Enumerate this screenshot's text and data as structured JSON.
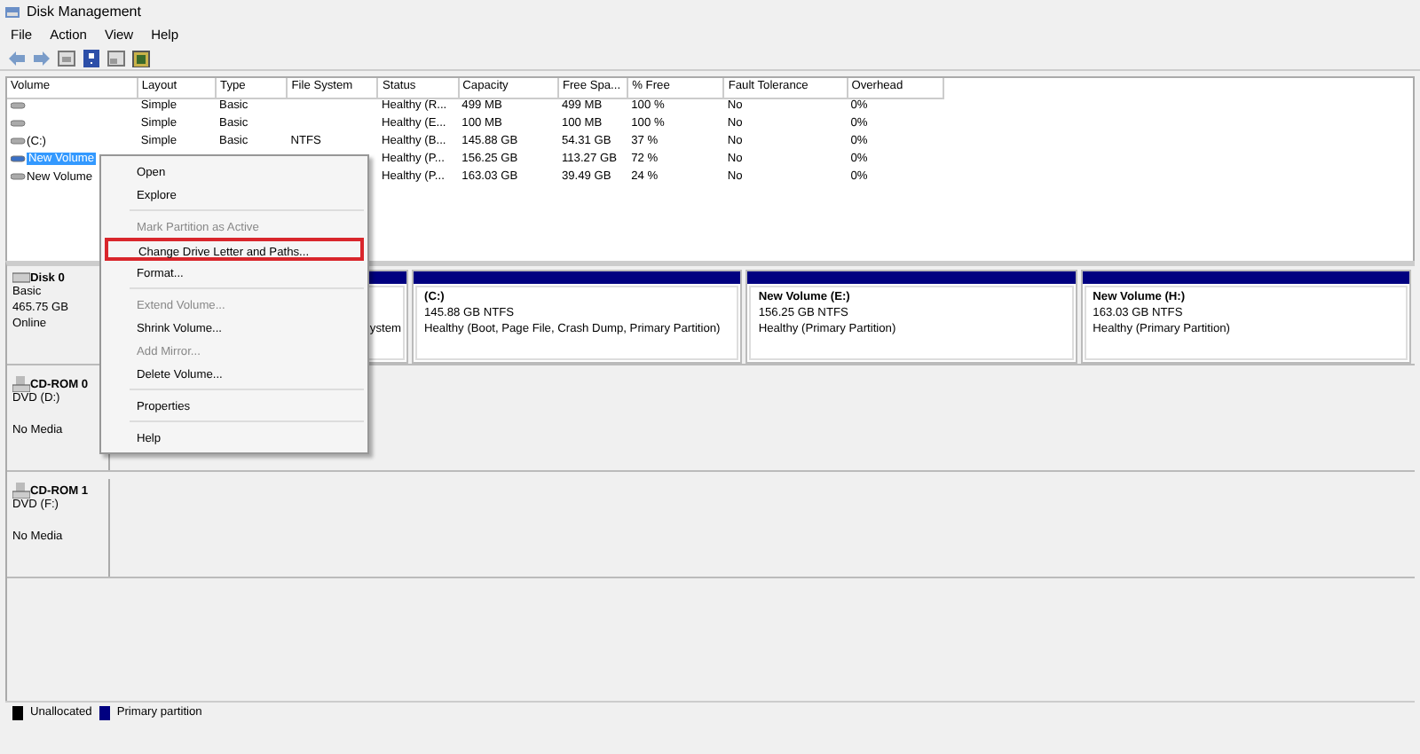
{
  "window": {
    "title": "Disk Management"
  },
  "menu_bar": [
    "File",
    "Action",
    "View",
    "Help"
  ],
  "table": {
    "columns": [
      "Volume",
      "Layout",
      "Type",
      "File System",
      "Status",
      "Capacity",
      "Free Spa...",
      "% Free",
      "Fault Tolerance",
      "Overhead"
    ],
    "rows": [
      {
        "selected": false,
        "cells": [
          "",
          "Simple",
          "Basic",
          "",
          "Healthy (R...",
          "499 MB",
          "499 MB",
          "100 %",
          "No",
          "0%"
        ]
      },
      {
        "selected": false,
        "cells": [
          "",
          "Simple",
          "Basic",
          "",
          "Healthy (E...",
          "100 MB",
          "100 MB",
          "100 %",
          "No",
          "0%"
        ]
      },
      {
        "selected": false,
        "cells": [
          "(C:)",
          "Simple",
          "Basic",
          "NTFS",
          "Healthy (B...",
          "145.88 GB",
          "54.31 GB",
          "37 %",
          "No",
          "0%"
        ]
      },
      {
        "selected": true,
        "cells": [
          "New Volume",
          "",
          "",
          "",
          "Healthy (P...",
          "156.25 GB",
          "113.27 GB",
          "72 %",
          "No",
          "0%"
        ]
      },
      {
        "selected": false,
        "cells": [
          "New Volume",
          "",
          "",
          "",
          "Healthy (P...",
          "163.03 GB",
          "39.49 GB",
          "24 %",
          "No",
          "0%"
        ]
      }
    ]
  },
  "disks": [
    {
      "kind": "disk",
      "name": "Disk 0",
      "lines": [
        "Basic",
        "465.75 GB",
        "Online"
      ],
      "partitions": [
        {
          "color": "#000080",
          "status": "ystem"
        },
        {
          "color": "#000080",
          "title": "(C:)",
          "size": "145.88 GB NTFS",
          "status": "Healthy (Boot, Page File, Crash Dump, Primary Partition)"
        },
        {
          "color": "#000080",
          "title": "New Volume  (E:)",
          "size": "156.25 GB NTFS",
          "status": "Healthy (Primary Partition)"
        },
        {
          "color": "#000080",
          "title": "New Volume  (H:)",
          "size": "163.03 GB NTFS",
          "status": "Healthy (Primary Partition)"
        }
      ]
    },
    {
      "kind": "cdrom",
      "name": "CD-ROM 0",
      "lines": [
        "DVD (D:)",
        "No Media"
      ]
    },
    {
      "kind": "cdrom",
      "name": "CD-ROM 1",
      "lines": [
        "DVD (F:)",
        "No Media"
      ]
    }
  ],
  "legend": [
    {
      "label": "Unallocated",
      "color": "#000000"
    },
    {
      "label": "Primary partition",
      "color": "#000080"
    }
  ],
  "context_menu": [
    {
      "kind": "item",
      "label": "Open",
      "disabled": false,
      "highlighted": false
    },
    {
      "kind": "item",
      "label": "Explore",
      "disabled": false,
      "highlighted": false
    },
    {
      "kind": "separator"
    },
    {
      "kind": "item",
      "label": "Mark Partition as Active",
      "disabled": true,
      "highlighted": false
    },
    {
      "kind": "item",
      "label": "Change Drive Letter and Paths...",
      "disabled": false,
      "highlighted": true
    },
    {
      "kind": "item",
      "label": "Format...",
      "disabled": false,
      "highlighted": false
    },
    {
      "kind": "separator"
    },
    {
      "kind": "item",
      "label": "Extend Volume...",
      "disabled": true,
      "highlighted": false
    },
    {
      "kind": "item",
      "label": "Shrink Volume...",
      "disabled": false,
      "highlighted": false
    },
    {
      "kind": "item",
      "label": "Add Mirror...",
      "disabled": true,
      "highlighted": false
    },
    {
      "kind": "item",
      "label": "Delete Volume...",
      "disabled": false,
      "highlighted": false
    },
    {
      "kind": "separator"
    },
    {
      "kind": "item",
      "label": "Properties",
      "disabled": false,
      "highlighted": false
    },
    {
      "kind": "separator"
    },
    {
      "kind": "item",
      "label": "Help",
      "disabled": false,
      "highlighted": false
    }
  ]
}
